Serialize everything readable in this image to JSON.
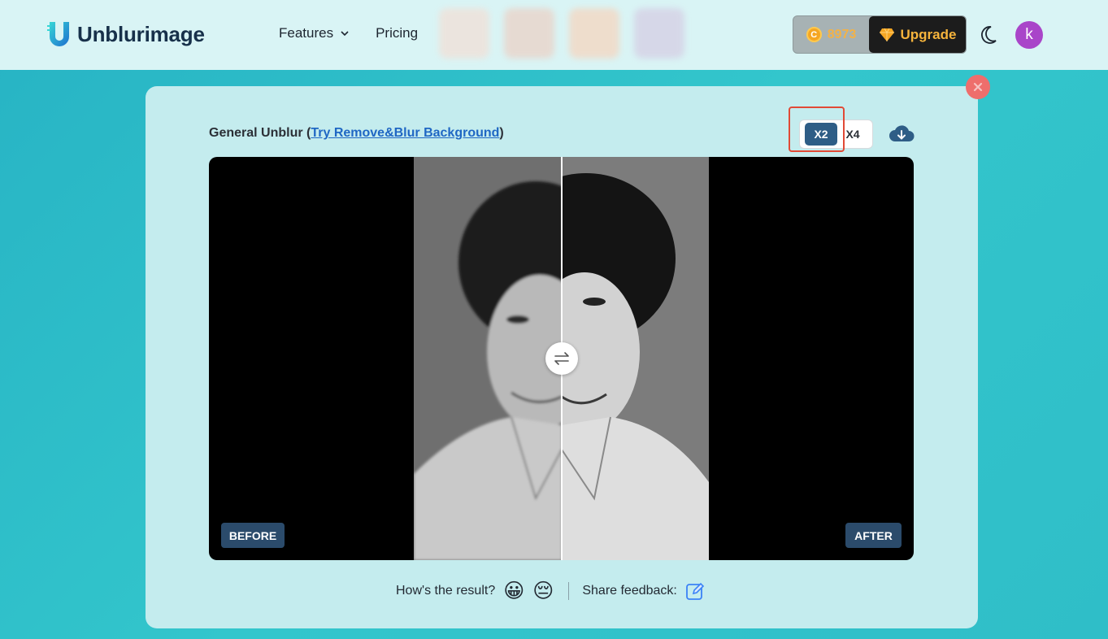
{
  "header": {
    "logo_text": "Unblurimage",
    "nav": [
      {
        "label": "Features",
        "has_dropdown": true
      },
      {
        "label": "Pricing",
        "has_dropdown": false
      }
    ],
    "credits": "8973",
    "upgrade_label": "Upgrade",
    "avatar_initial": "k"
  },
  "tool": {
    "title": "General Unblur (",
    "link_text": "Try Remove&Blur Background",
    "title_end": ")",
    "scale_options": [
      "X2",
      "X4"
    ],
    "selected_scale": "X2"
  },
  "viewer": {
    "before_label": "BEFORE",
    "after_label": "AFTER",
    "slider_position_percent": 50
  },
  "feedback": {
    "prompt": "How's the result?",
    "happy_emoji": "😀",
    "sad_emoji": "😔",
    "share_label": "Share feedback:"
  },
  "colors": {
    "accent": "#2e5d86",
    "upgrade_text": "#f6b43c",
    "avatar": "#a945c9",
    "close": "#ee6e6c",
    "highlight": "#e14a36"
  }
}
